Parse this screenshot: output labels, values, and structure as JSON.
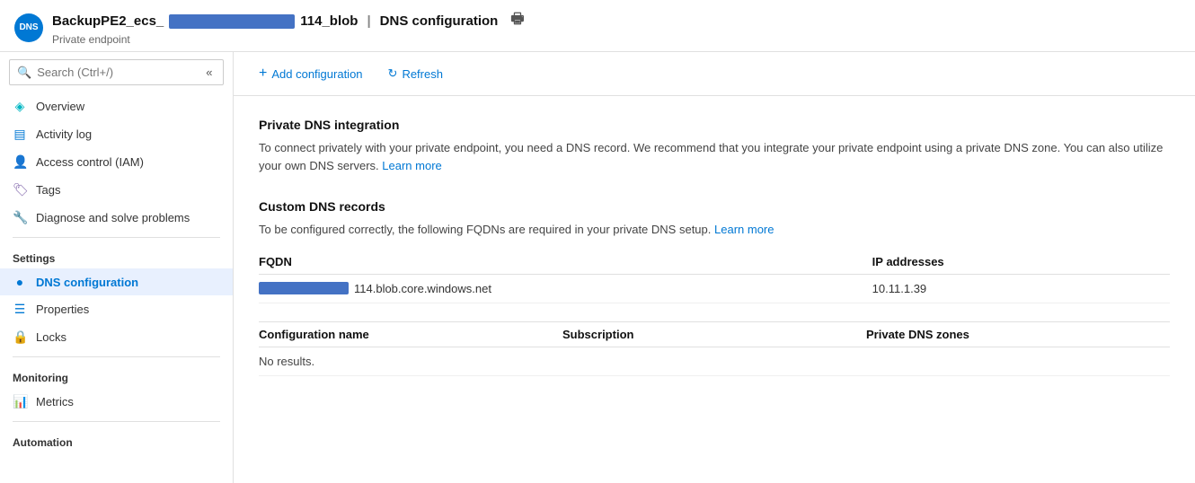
{
  "header": {
    "avatar_label": "DNS",
    "title_prefix": "BackupPE2_ecs_",
    "title_redacted": true,
    "title_suffix": "114_blob",
    "separator": "|",
    "page_title": "DNS configuration",
    "subtitle": "Private endpoint"
  },
  "sidebar": {
    "search_placeholder": "Search (Ctrl+/)",
    "collapse_label": "«",
    "nav_items": [
      {
        "id": "overview",
        "label": "Overview",
        "icon": "◈",
        "active": false
      },
      {
        "id": "activity-log",
        "label": "Activity log",
        "icon": "▤",
        "active": false
      },
      {
        "id": "access-control",
        "label": "Access control (IAM)",
        "icon": "👤",
        "active": false
      },
      {
        "id": "tags",
        "label": "Tags",
        "icon": "🏷",
        "active": false
      },
      {
        "id": "diagnose",
        "label": "Diagnose and solve problems",
        "icon": "🔧",
        "active": false
      }
    ],
    "settings_label": "Settings",
    "settings_items": [
      {
        "id": "dns-configuration",
        "label": "DNS configuration",
        "icon": "●",
        "active": true
      },
      {
        "id": "properties",
        "label": "Properties",
        "icon": "▤",
        "active": false
      },
      {
        "id": "locks",
        "label": "Locks",
        "icon": "🔒",
        "active": false
      }
    ],
    "monitoring_label": "Monitoring",
    "monitoring_items": [
      {
        "id": "metrics",
        "label": "Metrics",
        "icon": "📊",
        "active": false
      }
    ],
    "automation_label": "Automation"
  },
  "toolbar": {
    "add_label": "Add configuration",
    "refresh_label": "Refresh"
  },
  "content": {
    "private_dns": {
      "title": "Private DNS integration",
      "description": "To connect privately with your private endpoint, you need a DNS record. We recommend that you integrate your private endpoint using a private DNS zone. You can also utilize your own DNS servers.",
      "learn_more_label": "Learn more",
      "learn_more_url": "#"
    },
    "custom_dns": {
      "title": "Custom DNS records",
      "description": "To be configured correctly, the following FQDNs are required in your private DNS setup.",
      "learn_more_label": "Learn more",
      "learn_more_url": "#",
      "table": {
        "col_fqdn": "FQDN",
        "col_ip": "IP addresses",
        "rows": [
          {
            "fqdn_redacted": true,
            "fqdn_suffix": "114.blob.core.windows.net",
            "ip": "10.11.1.39"
          }
        ]
      }
    },
    "config_table": {
      "col_config_name": "Configuration name",
      "col_subscription": "Subscription",
      "col_dns_zones": "Private DNS zones",
      "no_results": "No results.",
      "rows": []
    }
  }
}
